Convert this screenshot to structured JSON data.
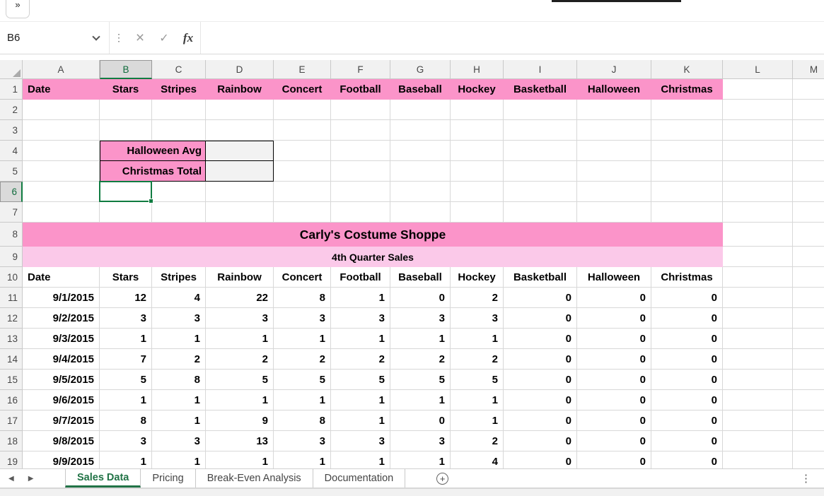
{
  "titlebar": {
    "collapse_chevrons": "»"
  },
  "formula_bar": {
    "name_box_value": "B6",
    "formula_value": ""
  },
  "icons": {
    "cancel": "×",
    "enter": "✓",
    "fx": "fx",
    "menu_dots": "⋮",
    "nav_prev": "◀",
    "nav_next": "▶"
  },
  "grid": {
    "column_headers": [
      "A",
      "B",
      "C",
      "D",
      "E",
      "F",
      "G",
      "H",
      "I",
      "J",
      "K",
      "L",
      "M"
    ],
    "row_headers": [
      "1",
      "2",
      "3",
      "4",
      "5",
      "6",
      "7",
      "8",
      "9",
      "10",
      "11",
      "12",
      "13",
      "14",
      "15",
      "16",
      "17",
      "18",
      "19"
    ],
    "selected_cell": "B6",
    "selected_column": "B",
    "selected_row": "6"
  },
  "sheet": {
    "header_row": [
      "Date",
      "Stars",
      "Stripes",
      "Rainbow",
      "Concert",
      "Football",
      "Baseball",
      "Hockey",
      "Basketball",
      "Halloween",
      "Christmas"
    ],
    "summary": [
      {
        "label": "Halloween Avg",
        "value": ""
      },
      {
        "label": "Christmas Total",
        "value": ""
      }
    ],
    "title": "Carly's Costume Shoppe",
    "subtitle": "4th Quarter Sales",
    "column_titles": [
      "Date",
      "Stars",
      "Stripes",
      "Rainbow",
      "Concert",
      "Football",
      "Baseball",
      "Hockey",
      "Basketball",
      "Halloween",
      "Christmas"
    ],
    "rows": [
      [
        "9/1/2015",
        "12",
        "4",
        "22",
        "8",
        "1",
        "0",
        "2",
        "0",
        "0",
        "0"
      ],
      [
        "9/2/2015",
        "3",
        "3",
        "3",
        "3",
        "3",
        "3",
        "3",
        "0",
        "0",
        "0"
      ],
      [
        "9/3/2015",
        "1",
        "1",
        "1",
        "1",
        "1",
        "1",
        "1",
        "0",
        "0",
        "0"
      ],
      [
        "9/4/2015",
        "7",
        "2",
        "2",
        "2",
        "2",
        "2",
        "2",
        "0",
        "0",
        "0"
      ],
      [
        "9/5/2015",
        "5",
        "8",
        "5",
        "5",
        "5",
        "5",
        "5",
        "0",
        "0",
        "0"
      ],
      [
        "9/6/2015",
        "1",
        "1",
        "1",
        "1",
        "1",
        "1",
        "1",
        "0",
        "0",
        "0"
      ],
      [
        "9/7/2015",
        "8",
        "1",
        "9",
        "8",
        "1",
        "0",
        "1",
        "0",
        "0",
        "0"
      ],
      [
        "9/8/2015",
        "3",
        "3",
        "13",
        "3",
        "3",
        "3",
        "2",
        "0",
        "0",
        "0"
      ],
      [
        "9/9/2015",
        "1",
        "1",
        "1",
        "1",
        "1",
        "1",
        "4",
        "0",
        "0",
        "0"
      ]
    ]
  },
  "sheet_tabs": {
    "items": [
      {
        "label": "Sales Data",
        "active": true
      },
      {
        "label": "Pricing",
        "active": false
      },
      {
        "label": "Break-Even Analysis",
        "active": false
      },
      {
        "label": "Documentation",
        "active": false
      }
    ],
    "add_button": "+"
  },
  "colors": {
    "header_pink": "#FB94C9",
    "subtitle_pink": "#FBC9E9",
    "summary_value_fill": "#F2F2F2",
    "selection_green": "#107C41",
    "active_tab_green": "#217346"
  }
}
